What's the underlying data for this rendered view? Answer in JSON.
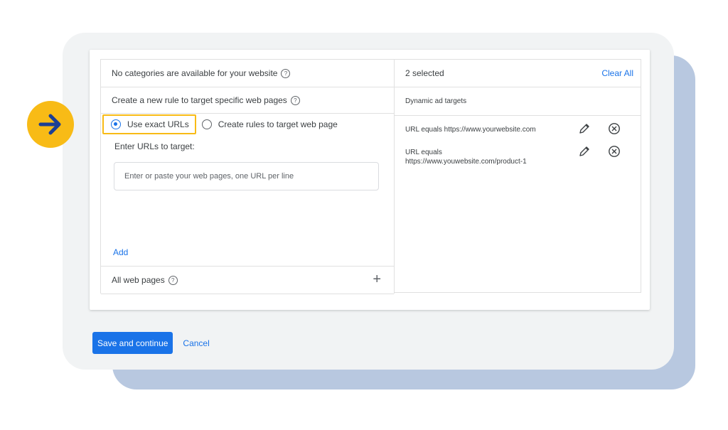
{
  "left": {
    "no_categories": "No categories are available for your website",
    "create_rule": "Create a new rule to target specific web pages",
    "radio_options": [
      {
        "label": "Use exact URLs",
        "checked": true
      },
      {
        "label": "Create rules to target web page",
        "checked": false
      }
    ],
    "enter_label": "Enter URLs to target:",
    "input_placeholder": "Enter or paste your web pages, one URL per line",
    "add_label": "Add",
    "all_web_pages": "All web pages",
    "plus_symbol": "+"
  },
  "right": {
    "selected_text": "2 selected",
    "clear_all": "Clear All",
    "subheader": "Dynamic ad targets",
    "targets": [
      {
        "line1": "URL equals https://www.yourwebsite.com",
        "line2": ""
      },
      {
        "line1": "URL equals",
        "line2": "https://www.youwebsite.com/product-1"
      }
    ]
  },
  "actions": {
    "save_label": "Save and continue",
    "cancel_label": "Cancel"
  },
  "help_symbol": "?",
  "colors": {
    "accent_blue": "#1a73e8",
    "highlight_yellow": "#f8bb16",
    "arrow_navy": "#1c3f94",
    "shadow_card": "#b8c8e0"
  },
  "icons": [
    "arrow-right-icon",
    "help-icon",
    "pencil-icon",
    "remove-circle-icon",
    "plus-icon"
  ]
}
